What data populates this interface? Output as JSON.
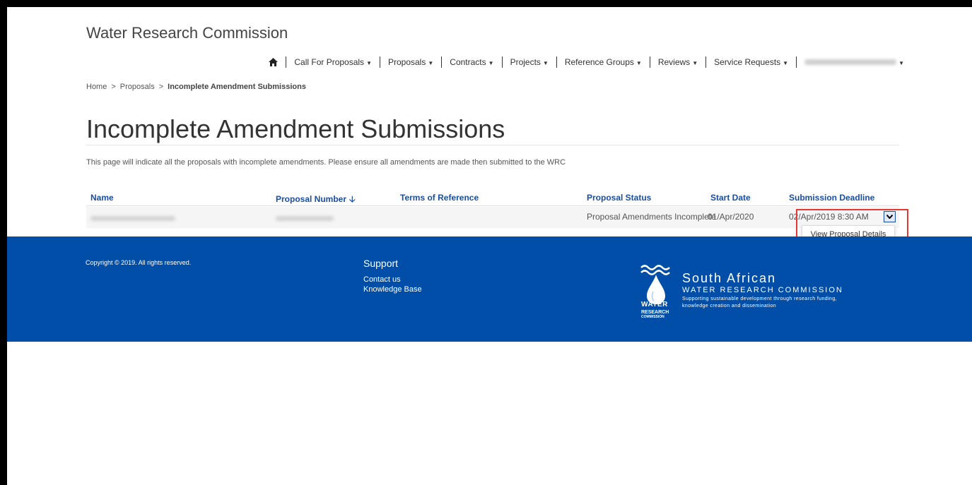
{
  "header": {
    "brand": "Water Research Commission",
    "nav": [
      {
        "label": "Call For Proposals"
      },
      {
        "label": "Proposals"
      },
      {
        "label": "Contracts"
      },
      {
        "label": "Projects"
      },
      {
        "label": "Reference Groups"
      },
      {
        "label": "Reviews"
      },
      {
        "label": "Service Requests"
      }
    ],
    "home_icon": "home-icon"
  },
  "breadcrumb": {
    "items": [
      "Home",
      "Proposals"
    ],
    "current": "Incomplete Amendment Submissions",
    "separator": ">"
  },
  "page": {
    "title": "Incomplete Amendment Submissions",
    "intro": "This page will indicate all the proposals with incomplete amendments. Please ensure all amendments are made then submitted to the WRC"
  },
  "table": {
    "columns": [
      "Name",
      "Proposal Number",
      "Terms of Reference",
      "Proposal Status",
      "Start Date",
      "Submission Deadline"
    ],
    "sort_icon": "sort-down-arrow-icon",
    "rows": [
      {
        "name": "",
        "proposal_number": "",
        "terms_of_reference": "",
        "status": "Proposal Amendments Incomplete",
        "start_date": "01/Apr/2020",
        "deadline": "02/Apr/2019 8:30 AM"
      }
    ],
    "row_menu": {
      "item": "View Proposal Details"
    }
  },
  "footer": {
    "copyright": "Copyright © 2019. All rights reserved.",
    "support_title": "Support",
    "links": [
      "Contact us",
      "Knowledge Base"
    ],
    "logo": {
      "word1": "WATER",
      "word2": "RESEARCH",
      "word3": "COMMISSION"
    },
    "org_line1": "South African",
    "org_line2": "WATER RESEARCH COMMISSION",
    "org_tag": "Supporting sustainable development through research funding, knowledge creation and dissemination",
    "background": "#004ea8"
  },
  "colors": {
    "accent": "#1b4da3",
    "highlight": "#e53935"
  }
}
